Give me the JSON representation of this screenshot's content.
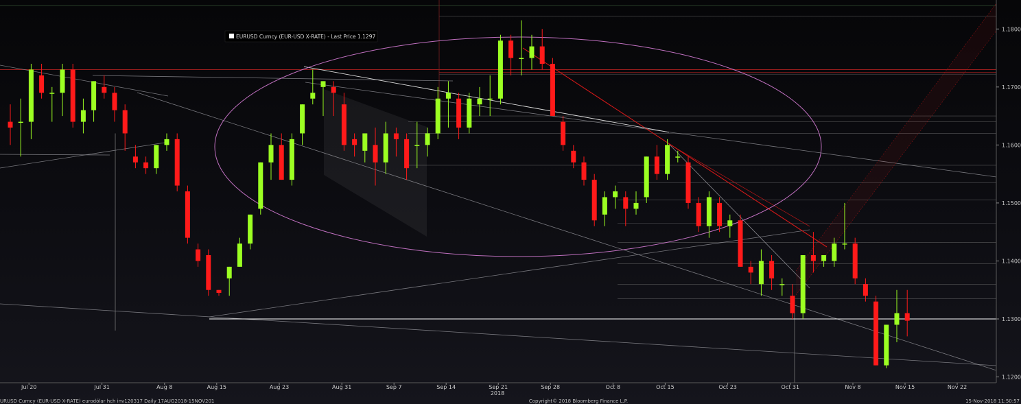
{
  "legend": {
    "label": "EURUSD Curncy (EUR-USD X-RATE) - Last Price 1.1297",
    "swatch_color": "#ffffff"
  },
  "colors": {
    "up": "#9cff22",
    "down": "#ff1a1a",
    "trend": "#8a8a90",
    "red_trend": "#d01818",
    "ellipse": "#c070c0",
    "support": "#ffffff"
  },
  "footer": {
    "left": "URUSD Curncy (EUR-USD X-RATE) eurodólar hch inv120317  Daily 17AUG2018-15NOV201",
    "center": "Copyright© 2018 Bloomberg Finance L.P.",
    "right": "15-Nov-2018 11:50:57"
  },
  "chart_data": {
    "type": "candlestick",
    "title": "",
    "y_axis": {
      "side": "right",
      "ticks": [
        "1.1800",
        "1.1700",
        "1.1600",
        "1.1500",
        "1.1400",
        "1.1300",
        "1.1200"
      ],
      "ylim": [
        1.119,
        1.185
      ]
    },
    "x_axis": {
      "ticks": [
        "Jul 20",
        "Jul 31",
        "Aug 8",
        "Aug 15",
        "Aug 23",
        "Aug 31",
        "Sep 7",
        "Sep 14",
        "Sep 21",
        "Sep 28",
        "Oct 8",
        "Oct 15",
        "Oct 23",
        "Oct 31",
        "Nov 8",
        "Nov 15",
        "Nov 22"
      ],
      "year_label": "2018"
    },
    "support_level": 1.13,
    "candles": [
      {
        "o": 1.164,
        "h": 1.167,
        "l": 1.16,
        "c": 1.163
      },
      {
        "o": 1.164,
        "h": 1.168,
        "l": 1.158,
        "c": 1.164
      },
      {
        "o": 1.164,
        "h": 1.174,
        "l": 1.161,
        "c": 1.173
      },
      {
        "o": 1.172,
        "h": 1.174,
        "l": 1.168,
        "c": 1.169
      },
      {
        "o": 1.169,
        "h": 1.17,
        "l": 1.164,
        "c": 1.169
      },
      {
        "o": 1.169,
        "h": 1.174,
        "l": 1.165,
        "c": 1.173
      },
      {
        "o": 1.173,
        "h": 1.174,
        "l": 1.163,
        "c": 1.164
      },
      {
        "o": 1.164,
        "h": 1.168,
        "l": 1.162,
        "c": 1.166
      },
      {
        "o": 1.166,
        "h": 1.171,
        "l": 1.164,
        "c": 1.171
      },
      {
        "o": 1.17,
        "h": 1.172,
        "l": 1.168,
        "c": 1.169
      },
      {
        "o": 1.169,
        "h": 1.17,
        "l": 1.164,
        "c": 1.166
      },
      {
        "o": 1.166,
        "h": 1.167,
        "l": 1.159,
        "c": 1.162
      },
      {
        "o": 1.158,
        "h": 1.16,
        "l": 1.156,
        "c": 1.157
      },
      {
        "o": 1.157,
        "h": 1.158,
        "l": 1.155,
        "c": 1.156
      },
      {
        "o": 1.156,
        "h": 1.16,
        "l": 1.155,
        "c": 1.16
      },
      {
        "o": 1.16,
        "h": 1.162,
        "l": 1.159,
        "c": 1.161
      },
      {
        "o": 1.161,
        "h": 1.162,
        "l": 1.152,
        "c": 1.153
      },
      {
        "o": 1.152,
        "h": 1.153,
        "l": 1.143,
        "c": 1.144
      },
      {
        "o": 1.142,
        "h": 1.143,
        "l": 1.139,
        "c": 1.14
      },
      {
        "o": 1.141,
        "h": 1.142,
        "l": 1.134,
        "c": 1.135
      },
      {
        "o": 1.135,
        "h": 1.135,
        "l": 1.134,
        "c": 1.1345
      },
      {
        "o": 1.137,
        "h": 1.139,
        "l": 1.134,
        "c": 1.139
      },
      {
        "o": 1.139,
        "h": 1.144,
        "l": 1.139,
        "c": 1.143
      },
      {
        "o": 1.143,
        "h": 1.148,
        "l": 1.142,
        "c": 1.148
      },
      {
        "o": 1.149,
        "h": 1.157,
        "l": 1.148,
        "c": 1.157
      },
      {
        "o": 1.157,
        "h": 1.162,
        "l": 1.154,
        "c": 1.16
      },
      {
        "o": 1.16,
        "h": 1.162,
        "l": 1.154,
        "c": 1.154
      },
      {
        "o": 1.154,
        "h": 1.162,
        "l": 1.153,
        "c": 1.161
      },
      {
        "o": 1.162,
        "h": 1.167,
        "l": 1.16,
        "c": 1.167
      },
      {
        "o": 1.168,
        "h": 1.173,
        "l": 1.167,
        "c": 1.169
      },
      {
        "o": 1.17,
        "h": 1.171,
        "l": 1.165,
        "c": 1.171
      },
      {
        "o": 1.17,
        "h": 1.171,
        "l": 1.165,
        "c": 1.169
      },
      {
        "o": 1.167,
        "h": 1.169,
        "l": 1.159,
        "c": 1.16
      },
      {
        "o": 1.161,
        "h": 1.162,
        "l": 1.158,
        "c": 1.16
      },
      {
        "o": 1.159,
        "h": 1.162,
        "l": 1.157,
        "c": 1.162
      },
      {
        "o": 1.16,
        "h": 1.163,
        "l": 1.153,
        "c": 1.157
      },
      {
        "o": 1.157,
        "h": 1.164,
        "l": 1.155,
        "c": 1.162
      },
      {
        "o": 1.162,
        "h": 1.163,
        "l": 1.158,
        "c": 1.161
      },
      {
        "o": 1.161,
        "h": 1.162,
        "l": 1.154,
        "c": 1.156
      },
      {
        "o": 1.16,
        "h": 1.164,
        "l": 1.156,
        "c": 1.16
      },
      {
        "o": 1.16,
        "h": 1.163,
        "l": 1.158,
        "c": 1.162
      },
      {
        "o": 1.162,
        "h": 1.17,
        "l": 1.161,
        "c": 1.168
      },
      {
        "o": 1.168,
        "h": 1.171,
        "l": 1.163,
        "c": 1.169
      },
      {
        "o": 1.168,
        "h": 1.169,
        "l": 1.161,
        "c": 1.163
      },
      {
        "o": 1.163,
        "h": 1.169,
        "l": 1.162,
        "c": 1.168
      },
      {
        "o": 1.167,
        "h": 1.17,
        "l": 1.165,
        "c": 1.168
      },
      {
        "o": 1.168,
        "h": 1.172,
        "l": 1.165,
        "c": 1.168
      },
      {
        "o": 1.168,
        "h": 1.179,
        "l": 1.167,
        "c": 1.178
      },
      {
        "o": 1.178,
        "h": 1.179,
        "l": 1.172,
        "c": 1.175
      },
      {
        "o": 1.175,
        "h": 1.1815,
        "l": 1.172,
        "c": 1.175
      },
      {
        "o": 1.175,
        "h": 1.179,
        "l": 1.173,
        "c": 1.177
      },
      {
        "o": 1.177,
        "h": 1.18,
        "l": 1.173,
        "c": 1.174
      },
      {
        "o": 1.174,
        "h": 1.175,
        "l": 1.165,
        "c": 1.165
      },
      {
        "o": 1.164,
        "h": 1.165,
        "l": 1.159,
        "c": 1.16
      },
      {
        "o": 1.159,
        "h": 1.16,
        "l": 1.156,
        "c": 1.157
      },
      {
        "o": 1.157,
        "h": 1.158,
        "l": 1.153,
        "c": 1.154
      },
      {
        "o": 1.154,
        "h": 1.155,
        "l": 1.146,
        "c": 1.147
      },
      {
        "o": 1.148,
        "h": 1.152,
        "l": 1.146,
        "c": 1.151
      },
      {
        "o": 1.151,
        "h": 1.153,
        "l": 1.149,
        "c": 1.152
      },
      {
        "o": 1.151,
        "h": 1.152,
        "l": 1.146,
        "c": 1.149
      },
      {
        "o": 1.149,
        "h": 1.152,
        "l": 1.148,
        "c": 1.15
      },
      {
        "o": 1.151,
        "h": 1.158,
        "l": 1.15,
        "c": 1.158
      },
      {
        "o": 1.158,
        "h": 1.16,
        "l": 1.154,
        "c": 1.155
      },
      {
        "o": 1.155,
        "h": 1.161,
        "l": 1.154,
        "c": 1.16
      },
      {
        "o": 1.158,
        "h": 1.159,
        "l": 1.157,
        "c": 1.158
      },
      {
        "o": 1.157,
        "h": 1.158,
        "l": 1.149,
        "c": 1.15
      },
      {
        "o": 1.15,
        "h": 1.151,
        "l": 1.145,
        "c": 1.146
      },
      {
        "o": 1.146,
        "h": 1.152,
        "l": 1.144,
        "c": 1.151
      },
      {
        "o": 1.15,
        "h": 1.151,
        "l": 1.145,
        "c": 1.146
      },
      {
        "o": 1.146,
        "h": 1.148,
        "l": 1.144,
        "c": 1.147
      },
      {
        "o": 1.147,
        "h": 1.148,
        "l": 1.139,
        "c": 1.139
      },
      {
        "o": 1.139,
        "h": 1.14,
        "l": 1.136,
        "c": 1.138
      },
      {
        "o": 1.136,
        "h": 1.142,
        "l": 1.134,
        "c": 1.14
      },
      {
        "o": 1.14,
        "h": 1.141,
        "l": 1.135,
        "c": 1.137
      },
      {
        "o": 1.136,
        "h": 1.137,
        "l": 1.134,
        "c": 1.136
      },
      {
        "o": 1.134,
        "h": 1.136,
        "l": 1.13,
        "c": 1.131
      },
      {
        "o": 1.131,
        "h": 1.141,
        "l": 1.13,
        "c": 1.141
      },
      {
        "o": 1.141,
        "h": 1.145,
        "l": 1.138,
        "c": 1.14
      },
      {
        "o": 1.14,
        "h": 1.141,
        "l": 1.139,
        "c": 1.141
      },
      {
        "o": 1.14,
        "h": 1.144,
        "l": 1.139,
        "c": 1.143
      },
      {
        "o": 1.143,
        "h": 1.15,
        "l": 1.142,
        "c": 1.143
      },
      {
        "o": 1.143,
        "h": 1.144,
        "l": 1.136,
        "c": 1.137
      },
      {
        "o": 1.136,
        "h": 1.137,
        "l": 1.133,
        "c": 1.134
      },
      {
        "o": 1.133,
        "h": 1.134,
        "l": 1.122,
        "c": 1.122
      },
      {
        "o": 1.122,
        "h": 1.129,
        "l": 1.1215,
        "c": 1.129
      },
      {
        "o": 1.129,
        "h": 1.135,
        "l": 1.126,
        "c": 1.131
      },
      {
        "o": 1.131,
        "h": 1.135,
        "l": 1.127,
        "c": 1.1297
      }
    ]
  }
}
